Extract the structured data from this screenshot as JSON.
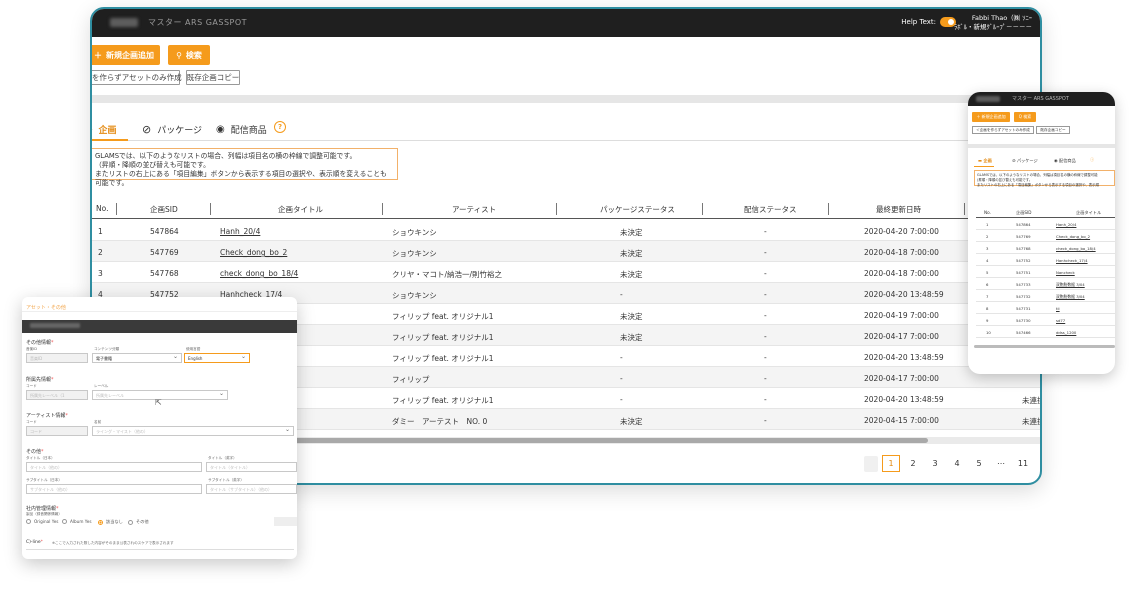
{
  "main": {
    "brand_text": "マスター ARS GASSPOT",
    "help_text": "Help Text:",
    "user_name": "Fabbi Thao（㈱ ｿﾆｰ",
    "user_sub": "ﾗﾎﾞﾙ・新規ｸﾞﾙｰﾌﾟ－－－－",
    "btn_new": "新規企画追加",
    "btn_search": "検索",
    "btn_asset_only": "画を作らずアセットのみ作成",
    "btn_copy": "既存企画コピー",
    "tabs": [
      {
        "label": "企画",
        "active": true
      },
      {
        "label": "パッケージ",
        "active": false
      },
      {
        "label": "配信商品",
        "active": false
      }
    ],
    "notice_lines": [
      "GLAMSでは、以下のようなリストの場合、列幅は項目名の横の枠線で調整可能です。",
      "（昇順・降順の並び替えも可能です。",
      "またリストの右上にある「項目編集」ボタンから表示する項目の選択や、表示順を変えることも可能です。"
    ],
    "columns": [
      "No.",
      "企画SID",
      "企画タイトル",
      "アーティスト",
      "パッケージステータス",
      "配信ステータス",
      "最終更新日時"
    ],
    "rows": [
      {
        "no": "1",
        "sid": "547864",
        "title": "Hanh_20/4",
        "artist": "ショウキンシ",
        "pkg": "未決定",
        "dist": "-",
        "updated": "2020-04-20 7:00:00"
      },
      {
        "no": "2",
        "sid": "547769",
        "title": "Check_dong_bo_2",
        "artist": "ショウキンシ",
        "pkg": "未決定",
        "dist": "-",
        "updated": "2020-04-18 7:00:00"
      },
      {
        "no": "3",
        "sid": "547768",
        "title": "check_dong_bo_18/4",
        "artist": "クリヤ・マコト/納浩一/則竹裕之",
        "pkg": "未決定",
        "dist": "-",
        "updated": "2020-04-18 7:00:00"
      },
      {
        "no": "4",
        "sid": "547752",
        "title": "Hanhcheck_17/4",
        "artist": "ショウキンシ",
        "pkg": "-",
        "dist": "-",
        "updated": "2020-04-20 13:48:59"
      },
      {
        "no": "",
        "sid": "",
        "title": "",
        "artist": "フィリップ feat. オリジナル1",
        "pkg": "未決定",
        "dist": "-",
        "updated": "2020-04-19 7:00:00"
      },
      {
        "no": "",
        "sid": "",
        "title": "",
        "artist": "フィリップ feat. オリジナル1",
        "pkg": "未決定",
        "dist": "-",
        "updated": "2020-04-17 7:00:00"
      },
      {
        "no": "",
        "sid": "",
        "title": "",
        "artist": "フィリップ feat. オリジナル1",
        "pkg": "-",
        "dist": "-",
        "updated": "2020-04-20 13:48:59"
      },
      {
        "no": "",
        "sid": "",
        "title": "",
        "artist": "フィリップ",
        "pkg": "-",
        "dist": "-",
        "updated": "2020-04-17 7:00:00"
      },
      {
        "no": "",
        "sid": "",
        "title": "",
        "artist": "フィリップ feat. オリジナル1",
        "pkg": "-",
        "dist": "-",
        "updated": "2020-04-20 13:48:59",
        "extra": "未連携"
      },
      {
        "no": "",
        "sid": "",
        "title": "",
        "artist": "ダミー　アーテスト　NO. 0",
        "pkg": "未決定",
        "dist": "-",
        "updated": "2020-04-15 7:00:00",
        "extra": "未連携"
      }
    ],
    "pages": [
      "1",
      "2",
      "3",
      "4",
      "5",
      "⋯",
      "11"
    ],
    "current_page": "1"
  },
  "mini": {
    "brand": "マスター ARS GASSPOT",
    "btn_new": "＋ 新規企画追加",
    "btn_search": "Q 検索",
    "btn_asset": "＜企画を作らずアセットのみ作成",
    "btn_copy": "既存企画コピー",
    "tabs": [
      "企画",
      "パッケージ",
      "配信商品"
    ],
    "notice": "GLAMSでは、以下のようなリストの場合、列幅は項目名の横の枠線で調整可能",
    "notice2": "(昇順・降順の並び替えも可能です。",
    "notice3": "またリストの右上にある「項目編集」ボタンから表示する項目の選択や、表示順",
    "columns": [
      "No.",
      "企画SID",
      "企画タイトル"
    ],
    "rows": [
      {
        "no": "1",
        "sid": "547864",
        "title": "Hanh_20/4"
      },
      {
        "no": "2",
        "sid": "547769",
        "title": "Check_dong_bo_2"
      },
      {
        "no": "3",
        "sid": "547768",
        "title": "check_dong_bo_18/4"
      },
      {
        "no": "4",
        "sid": "547752",
        "title": "Hanhcheck_17/4"
      },
      {
        "no": "5",
        "sid": "547751",
        "title": "Nancheck"
      },
      {
        "no": "6",
        "sid": "547733",
        "title": "双胞胎数据 3/04"
      },
      {
        "no": "7",
        "sid": "547732",
        "title": "双胞胎数据 3/04"
      },
      {
        "no": "8",
        "sid": "547731",
        "title": "tii"
      },
      {
        "no": "9",
        "sid": "547730",
        "title": "sd77"
      },
      {
        "no": "10",
        "sid": "547466",
        "title": "ddss_1200"
      }
    ]
  },
  "form": {
    "header": "アセット・その他",
    "sections": {
      "other_info": "その他情報",
      "label_info": "所属先情報",
      "artist_info": "アーティスト情報",
      "other": "その他",
      "internal": "社内管理情報"
    },
    "labels": {
      "area": "音楽ID",
      "content": "コンテンツ分類",
      "lang": "使用言語",
      "code": "コード",
      "label": "レーベル",
      "artist_code": "コード",
      "artist_name": "名前",
      "title_ja": "タイトル（日本）",
      "title_en": "タイトル（英字）",
      "subtitle_ja": "サブタイトル（日本）",
      "subtitle_en": "サブタイトル（英字）",
      "internal_sub": "製品（録音関係情報）",
      "cline": "C)-line",
      "cline_note": "※ここで入力された際した内容がそのまま公表されのスケアで表示されます"
    },
    "values": {
      "area": "音楽ID",
      "content": "電子書籍",
      "lang": "English",
      "code_ph": "所属先レーベル（1",
      "label_ph": "所属先レーベル",
      "artist_code_ph": "コード",
      "artist_name_ph": "ライング・マイスト（他の）",
      "title_ja_ph": "タイトル（他の）",
      "title_en_ph": "タイトル（タイトル）",
      "subtitle_ja_ph": "サブタイトル（他の）",
      "subtitle_en_ph": "タイトル（サブタイトル）（他の）"
    },
    "radios": [
      "Original Yes",
      "Album Yes",
      "該当なし",
      "その他"
    ],
    "radio_selected": "該当なし"
  },
  "colors": {
    "accent": "#f59b1c",
    "frame": "#2f8ea1",
    "topbar": "#1f1f1f"
  }
}
